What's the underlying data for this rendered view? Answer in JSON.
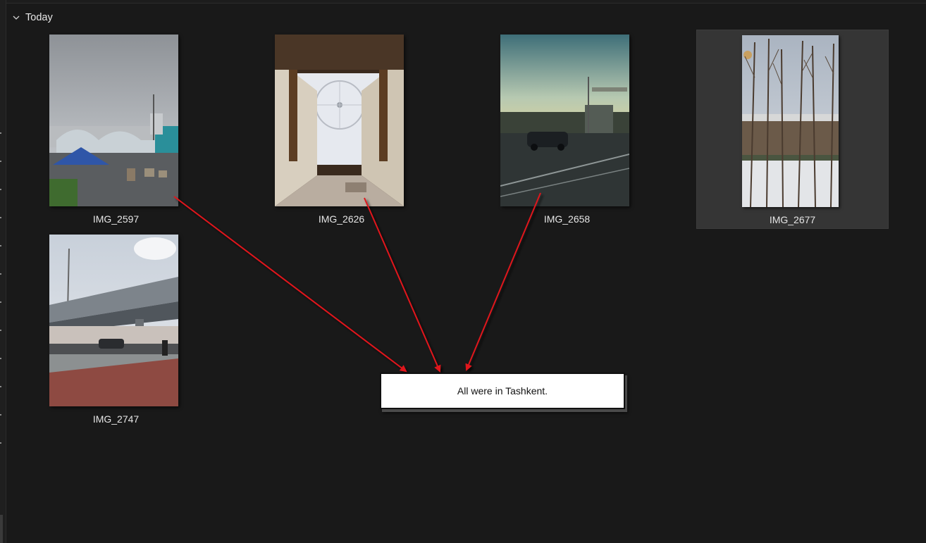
{
  "group": {
    "label": "Today",
    "expanded": true
  },
  "photos": [
    {
      "name": "IMG_2597",
      "selected": false
    },
    {
      "name": "IMG_2626",
      "selected": false
    },
    {
      "name": "IMG_2658",
      "selected": false
    },
    {
      "name": "IMG_2677",
      "selected": true
    },
    {
      "name": "IMG_2747",
      "selected": false
    }
  ],
  "annotation": {
    "text": "All were in Tashkent.",
    "arrow_color": "#e0161d"
  },
  "colors": {
    "background": "#191919",
    "selection": "#353535",
    "text": "#e6e6e6"
  }
}
